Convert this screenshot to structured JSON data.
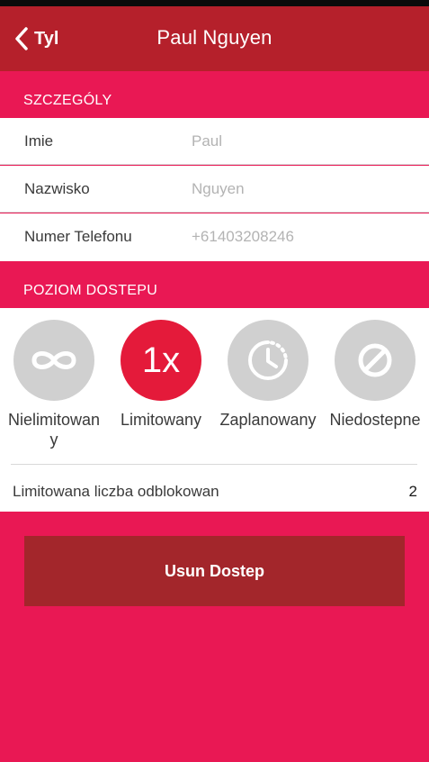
{
  "nav": {
    "back_label": "Tyl",
    "title": "Paul Nguyen"
  },
  "details": {
    "header": "SZCZEGÓLY",
    "rows": [
      {
        "label": "Imie",
        "value": "Paul"
      },
      {
        "label": "Nazwisko",
        "value": "Nguyen"
      },
      {
        "label": "Numer Telefonu",
        "value": "+61403208246"
      }
    ]
  },
  "access": {
    "header": "POZIOM DOSTEPU",
    "options": [
      {
        "label": "Nielimitowany",
        "icon": "infinity-icon",
        "selected": false
      },
      {
        "label": "Limitowany",
        "icon": "1x",
        "selected": true
      },
      {
        "label": "Zaplanowany",
        "icon": "clock-icon",
        "selected": false
      },
      {
        "label": "Niedostepne",
        "icon": "no-access-icon",
        "selected": false
      }
    ],
    "limit_label": "Limitowana liczba odblokowan",
    "limit_value": "2"
  },
  "remove_button": "Usun Dostep",
  "colors": {
    "navbar": "#b5202b",
    "background": "#e91854",
    "selected": "#e41a3a",
    "unselected": "#d0d0d0",
    "button": "#a3262b"
  }
}
